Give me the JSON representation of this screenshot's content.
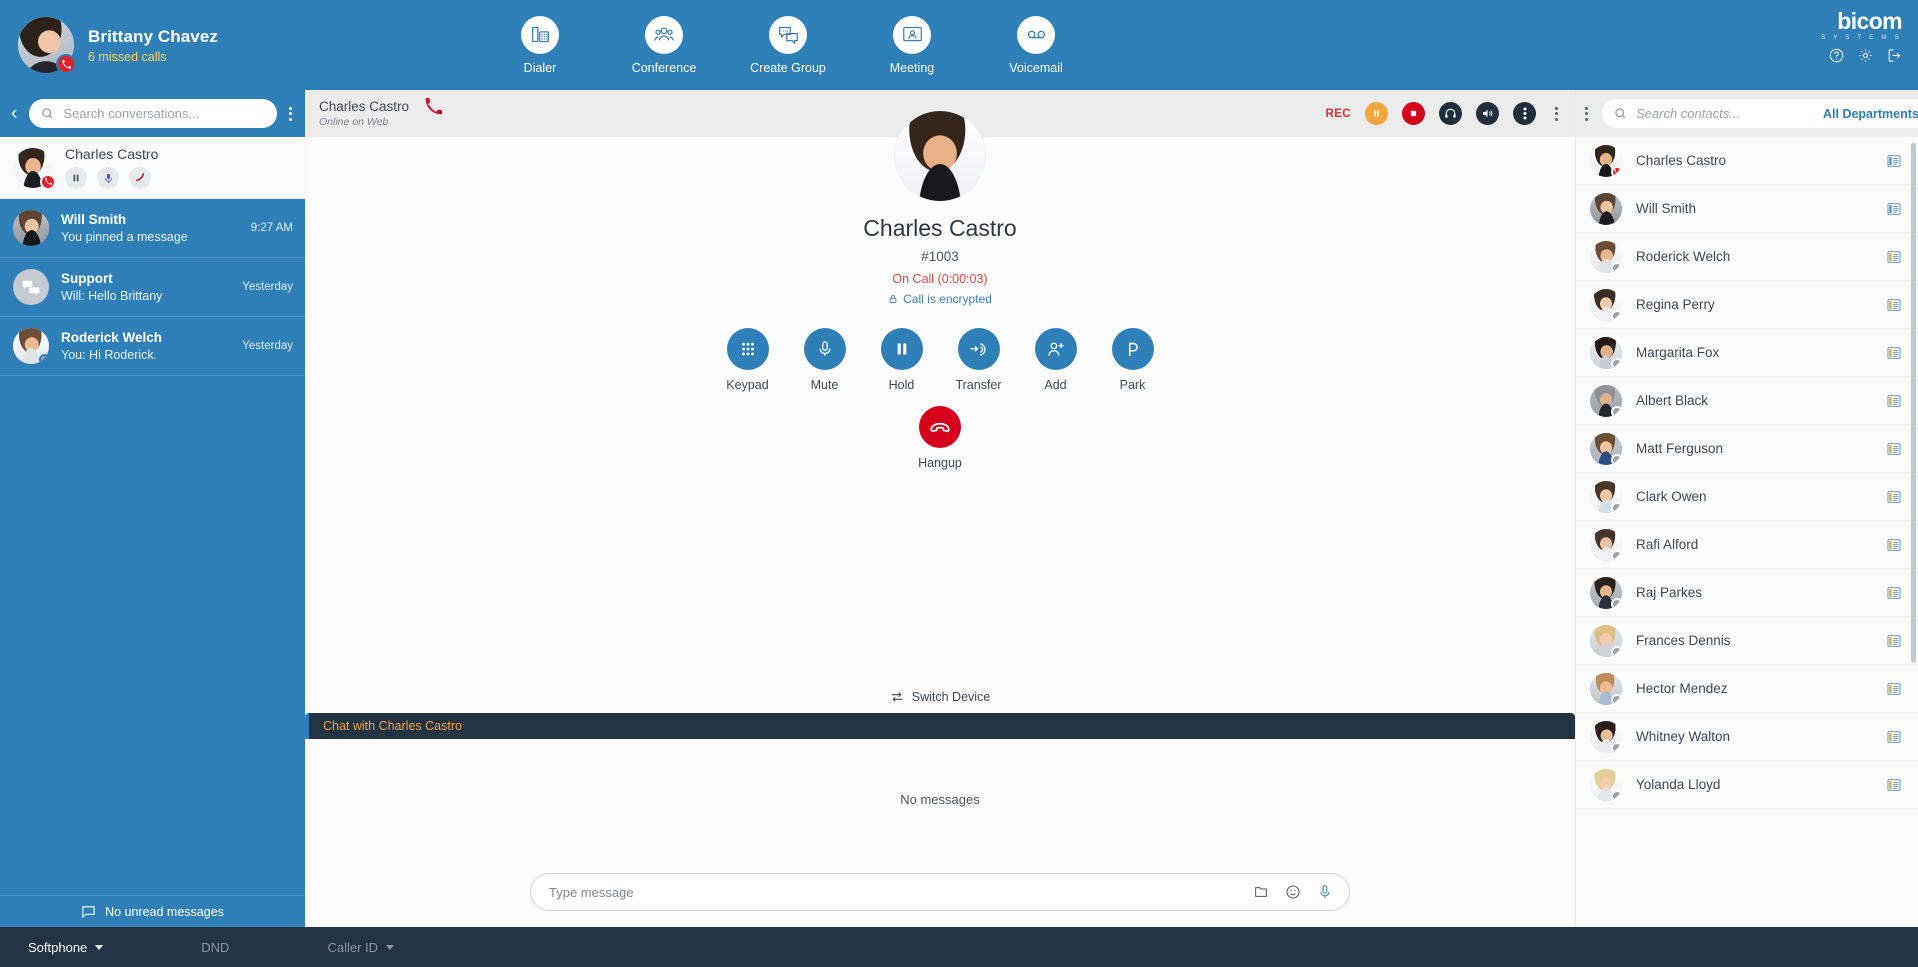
{
  "header": {
    "user": {
      "name": "Brittany Chavez",
      "missed": "6 missed calls",
      "badge_icon": "phone-icon"
    },
    "nav": [
      {
        "label": "Dialer",
        "icon": "desk-phone-icon"
      },
      {
        "label": "Conference",
        "icon": "people-group-icon"
      },
      {
        "label": "Create Group",
        "icon": "chat-bubbles-icon"
      },
      {
        "label": "Meeting",
        "icon": "video-meeting-icon"
      },
      {
        "label": "Voicemail",
        "icon": "voicemail-icon"
      }
    ],
    "brand": {
      "word": "bicom",
      "sub": "S Y S T E M S"
    },
    "brand_icons": [
      {
        "name": "help-icon"
      },
      {
        "name": "settings-gear-icon"
      },
      {
        "name": "logout-icon"
      }
    ],
    "accent_blue": "#2f7fb8",
    "accent_yellow": "#ffd34e"
  },
  "sidebar": {
    "search_placeholder": "Search conversations...",
    "back_chevron": "‹",
    "active_call": {
      "name": "Charles Castro",
      "buttons": [
        {
          "name": "hold-button",
          "icon": "pause-icon"
        },
        {
          "name": "mute-button",
          "icon": "microphone-icon"
        },
        {
          "name": "hangup-button",
          "icon": "hangup-icon"
        }
      ]
    },
    "conversations": [
      {
        "name": "Will Smith",
        "preview": "You pinned a message",
        "time": "9:27 AM",
        "avatar": "man-phone"
      },
      {
        "name": "Support",
        "preview": "Will: Hello Brittany",
        "time": "Yesterday",
        "avatar": "group-chat"
      },
      {
        "name": "Roderick Welch",
        "preview": "You: Hi Roderick.",
        "time": "Yesterday",
        "avatar": "man-phone-2"
      }
    ],
    "footer": {
      "label": "No unread messages",
      "icon": "chat-icon"
    }
  },
  "call_header": {
    "name": "Charles Castro",
    "status": "Online on Web",
    "phone_icon": "red-phone-icon",
    "rec_label": "REC",
    "controls": [
      {
        "name": "pause-recording-button",
        "icon": "pause-icon",
        "color": "#f0a73c"
      },
      {
        "name": "stop-recording-button",
        "icon": "stop-icon",
        "color": "#d6001c"
      },
      {
        "name": "headset-button",
        "icon": "headset-icon",
        "color": "#1f2e3d"
      },
      {
        "name": "speaker-button",
        "icon": "speaker-icon",
        "color": "#1f2e3d"
      },
      {
        "name": "more-options-button",
        "icon": "more-vertical-icon",
        "color": "#1f2e3d"
      }
    ]
  },
  "call": {
    "name": "Charles Castro",
    "extension": "#1003",
    "state": "On Call (0:00:03)",
    "encrypted": "Call is encrypted",
    "encrypted_icon": "lock-icon",
    "actions": [
      {
        "label": "Keypad",
        "icon": "keypad-icon"
      },
      {
        "label": "Mute",
        "icon": "microphone-icon"
      },
      {
        "label": "Hold",
        "icon": "pause-icon"
      },
      {
        "label": "Transfer",
        "icon": "transfer-icon"
      },
      {
        "label": "Add",
        "icon": "add-person-icon"
      },
      {
        "label": "Park",
        "icon": "park-p-icon"
      }
    ],
    "hangup": {
      "label": "Hangup",
      "icon": "hangup-icon"
    },
    "switch_device": {
      "label": "Switch Device",
      "icon": "swap-icon"
    }
  },
  "chat": {
    "header": "Chat with Charles Castro",
    "empty": "No messages",
    "input_placeholder": "Type message",
    "icons": [
      {
        "name": "attach-file-icon"
      },
      {
        "name": "emoji-icon"
      },
      {
        "name": "voice-record-icon"
      }
    ]
  },
  "contacts": {
    "search_placeholder": "Search contacts...",
    "department": "All Departments",
    "forward_chevron": "›",
    "items": [
      {
        "name": "Charles Castro",
        "status": "on-call"
      },
      {
        "name": "Will Smith",
        "status": "none"
      },
      {
        "name": "Roderick Welch",
        "status": "offline"
      },
      {
        "name": "Regina Perry",
        "status": "offline"
      },
      {
        "name": "Margarita Fox",
        "status": "offline"
      },
      {
        "name": "Albert Black",
        "status": "offline"
      },
      {
        "name": "Matt Ferguson",
        "status": "offline"
      },
      {
        "name": "Clark Owen",
        "status": "offline"
      },
      {
        "name": "Rafi Alford",
        "status": "offline"
      },
      {
        "name": "Raj Parkes",
        "status": "offline"
      },
      {
        "name": "Frances Dennis",
        "status": "offline"
      },
      {
        "name": "Hector Mendez",
        "status": "offline"
      },
      {
        "name": "Whitney Walton",
        "status": "offline"
      },
      {
        "name": "Yolanda Lloyd",
        "status": "offline"
      }
    ]
  },
  "bottombar": {
    "softphone": "Softphone",
    "dnd": "DND",
    "caller_id": "Caller ID"
  }
}
